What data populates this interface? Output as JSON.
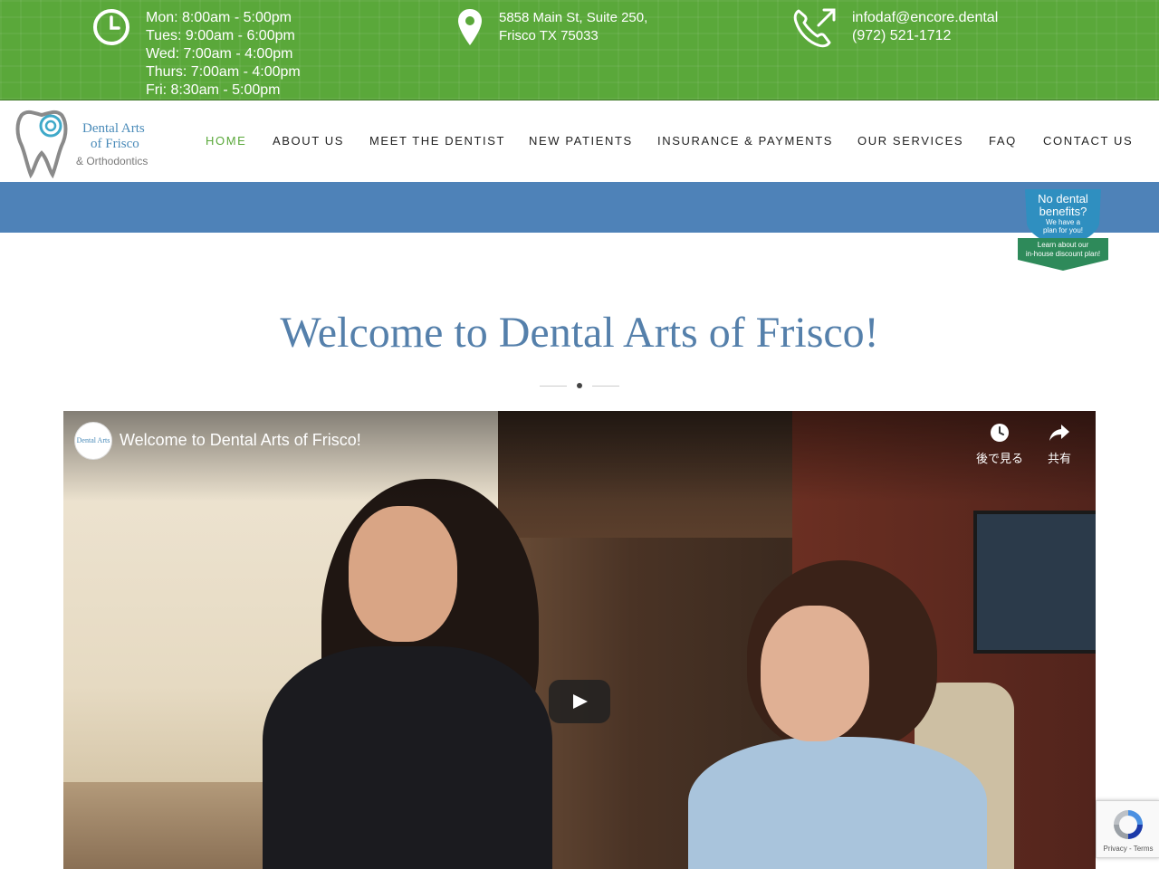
{
  "topbar": {
    "hours": [
      "Mon: 8:00am - 5:00pm",
      "Tues: 9:00am - 6:00pm",
      "Wed: 7:00am - 4:00pm",
      "Thurs: 7:00am - 4:00pm",
      "Fri: 8:30am - 5:00pm"
    ],
    "address_line1": "5858 Main St, Suite 250,",
    "address_line2": "Frisco TX 75033",
    "email": "infodaf@encore.dental",
    "phone": "(972) 521-1712",
    "icons": {
      "hours": "clock-icon",
      "address": "map-pin-icon",
      "contact": "phone-icon"
    }
  },
  "logo": {
    "line1": "Dental Arts",
    "line2": "of Frisco",
    "line3": "& Orthodontics"
  },
  "nav": {
    "items": [
      {
        "label": "HOME",
        "active": true
      },
      {
        "label": "ABOUT US"
      },
      {
        "label": "MEET THE DENTIST"
      },
      {
        "label": "NEW PATIENTS"
      },
      {
        "label": "INSURANCE & PAYMENTS"
      },
      {
        "label": "OUR SERVICES"
      },
      {
        "label": "FAQ"
      },
      {
        "label": "CONTACT US"
      }
    ]
  },
  "badge": {
    "line1": "No dental",
    "line1b": "benefits?",
    "line2": "We have a",
    "line2b": "plan for you!",
    "line3": "Learn about our",
    "line3b": "in-house discount plan!"
  },
  "main": {
    "welcome": "Welcome to Dental Arts of Frisco!"
  },
  "video": {
    "title": "Welcome to Dental Arts of Frisco!",
    "channel_logo_text": "Dental Arts",
    "watch_later": "後で見る",
    "share": "共有"
  },
  "recaptcha": {
    "text": "Privacy - Terms"
  },
  "colors": {
    "topbar_green": "#5aa83a",
    "nav_active": "#5aa83a",
    "band_blue": "#4e82b8",
    "heading_blue": "#5580ab",
    "badge_blue": "#2f8fc0",
    "badge_green": "#2e8a5a"
  }
}
